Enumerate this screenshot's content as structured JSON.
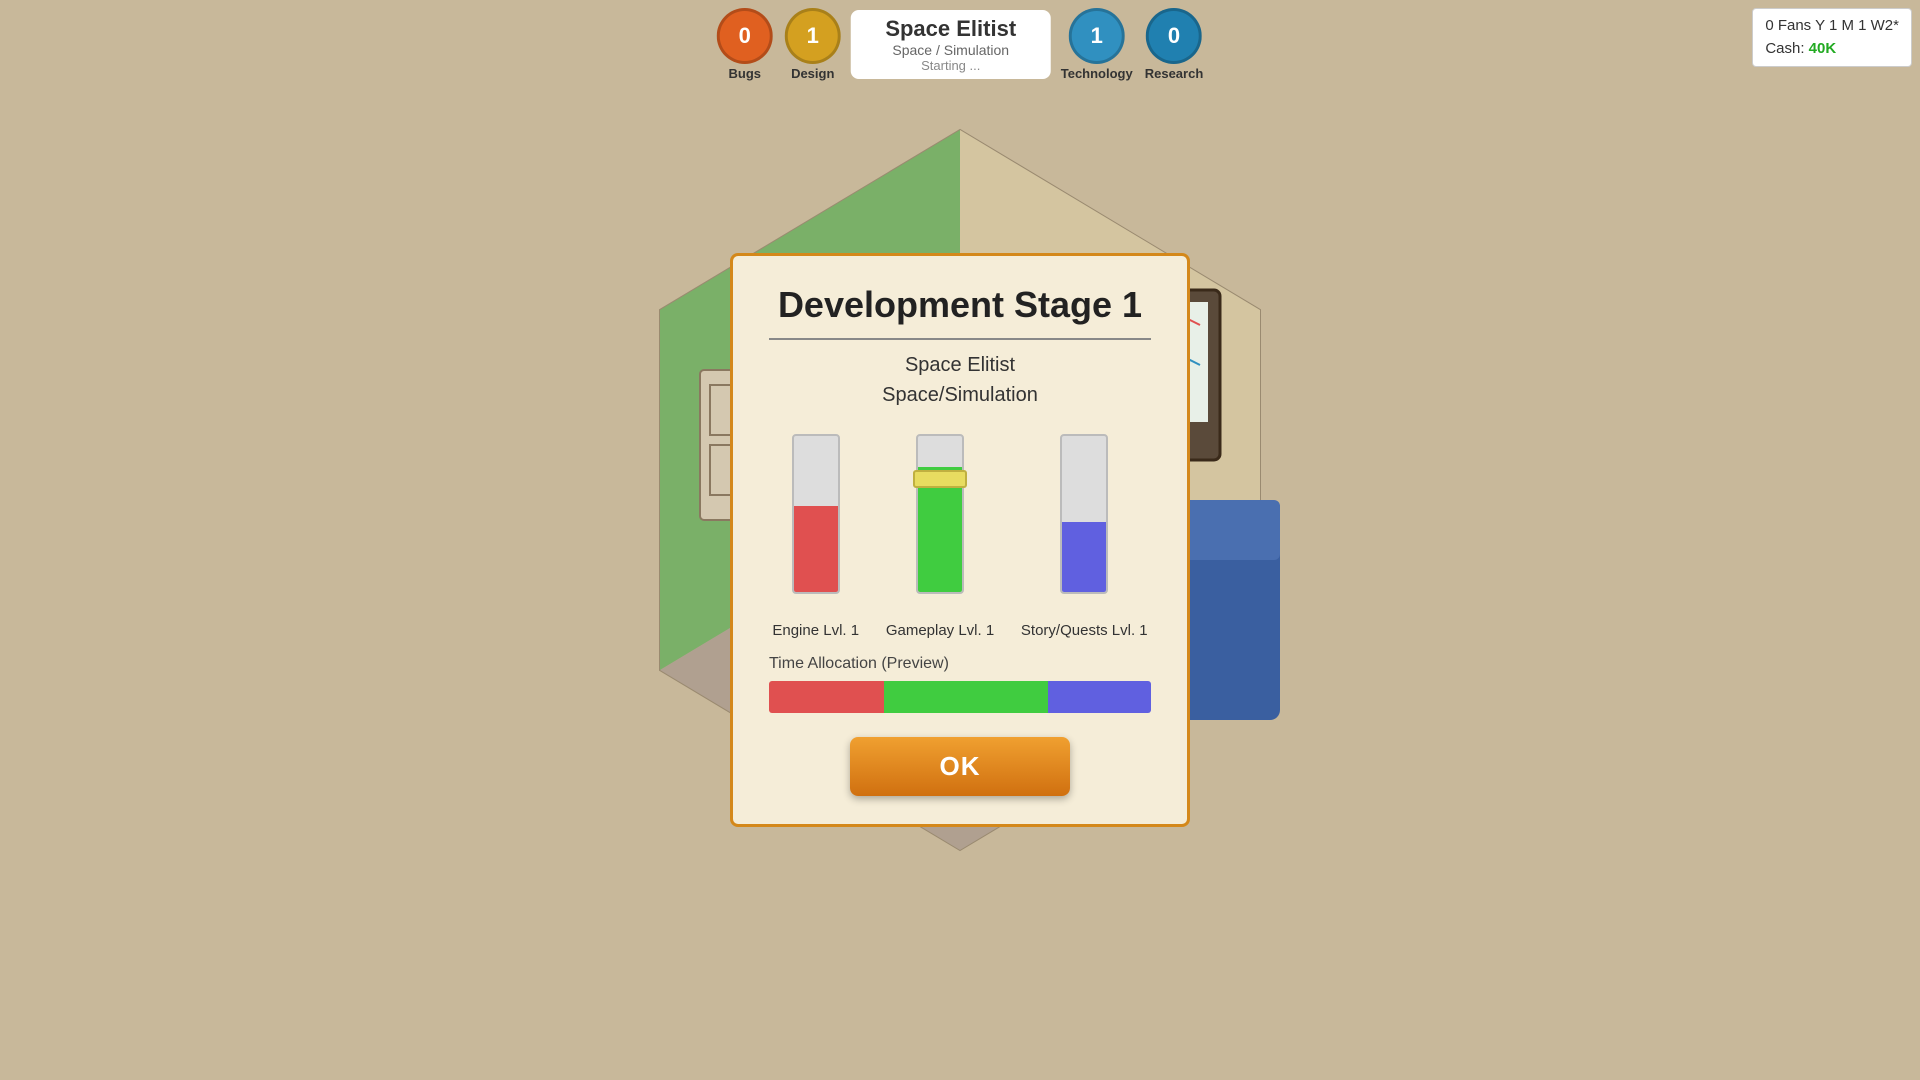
{
  "hud": {
    "bugs": {
      "value": "0",
      "label": "Bugs",
      "color": "#e06020"
    },
    "design": {
      "value": "1",
      "label": "Design",
      "color": "#d4a020"
    },
    "game_title": "Space Elitist",
    "game_genre": "Space / Simulation",
    "game_status": "Starting ...",
    "technology": {
      "value": "1",
      "label": "Technology",
      "color": "#3090c0"
    },
    "research": {
      "value": "0",
      "label": "Research",
      "color": "#2080b0"
    }
  },
  "top_right": {
    "fans": "0 Fans Y 1 M 1 W2*",
    "cash_label": "Cash:",
    "cash_value": "40K",
    "cash_color": "#22aa22"
  },
  "dialog": {
    "title": "Development Stage 1",
    "game_name": "Space Elitist",
    "game_genre": "Space/Simulation",
    "sliders": [
      {
        "label": "Engine Lvl. 1",
        "fill_color": "#e05050",
        "fill_pct": 55,
        "has_handle": false
      },
      {
        "label": "Gameplay Lvl. 1",
        "fill_color": "#40cc40",
        "fill_pct": 80,
        "has_handle": true
      },
      {
        "label": "Story/Quests Lvl. 1",
        "fill_color": "#6060e0",
        "fill_pct": 45,
        "has_handle": false
      }
    ],
    "time_allocation_label": "Time Allocation (Preview)",
    "time_bars": [
      {
        "color": "#e05050",
        "width_pct": 30
      },
      {
        "color": "#40cc40",
        "width_pct": 43
      },
      {
        "color": "#6060e0",
        "width_pct": 27
      }
    ],
    "ok_button_label": "OK"
  }
}
